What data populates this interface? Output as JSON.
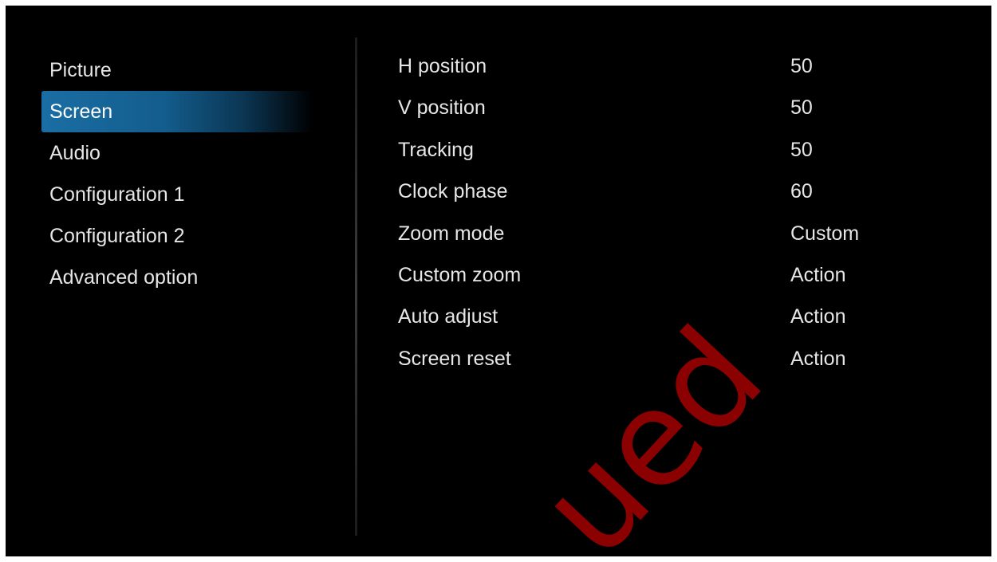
{
  "menu": {
    "items": [
      {
        "label": "Picture"
      },
      {
        "label": "Screen"
      },
      {
        "label": "Audio"
      },
      {
        "label": "Configuration 1"
      },
      {
        "label": "Configuration 2"
      },
      {
        "label": "Advanced option"
      }
    ],
    "selected": "Screen",
    "highlight_color": "#1a6ea4"
  },
  "settings": [
    {
      "label": "H position",
      "value": "50"
    },
    {
      "label": "V position",
      "value": "50"
    },
    {
      "label": "Tracking",
      "value": "50"
    },
    {
      "label": "Clock phase",
      "value": "60"
    },
    {
      "label": "Zoom mode",
      "value": "Custom"
    },
    {
      "label": "Custom zoom",
      "value": "Action"
    },
    {
      "label": "Auto adjust",
      "value": "Action"
    },
    {
      "label": "Screen reset",
      "value": "Action"
    }
  ],
  "watermark": {
    "text": "ued",
    "color": "#8b0000"
  }
}
